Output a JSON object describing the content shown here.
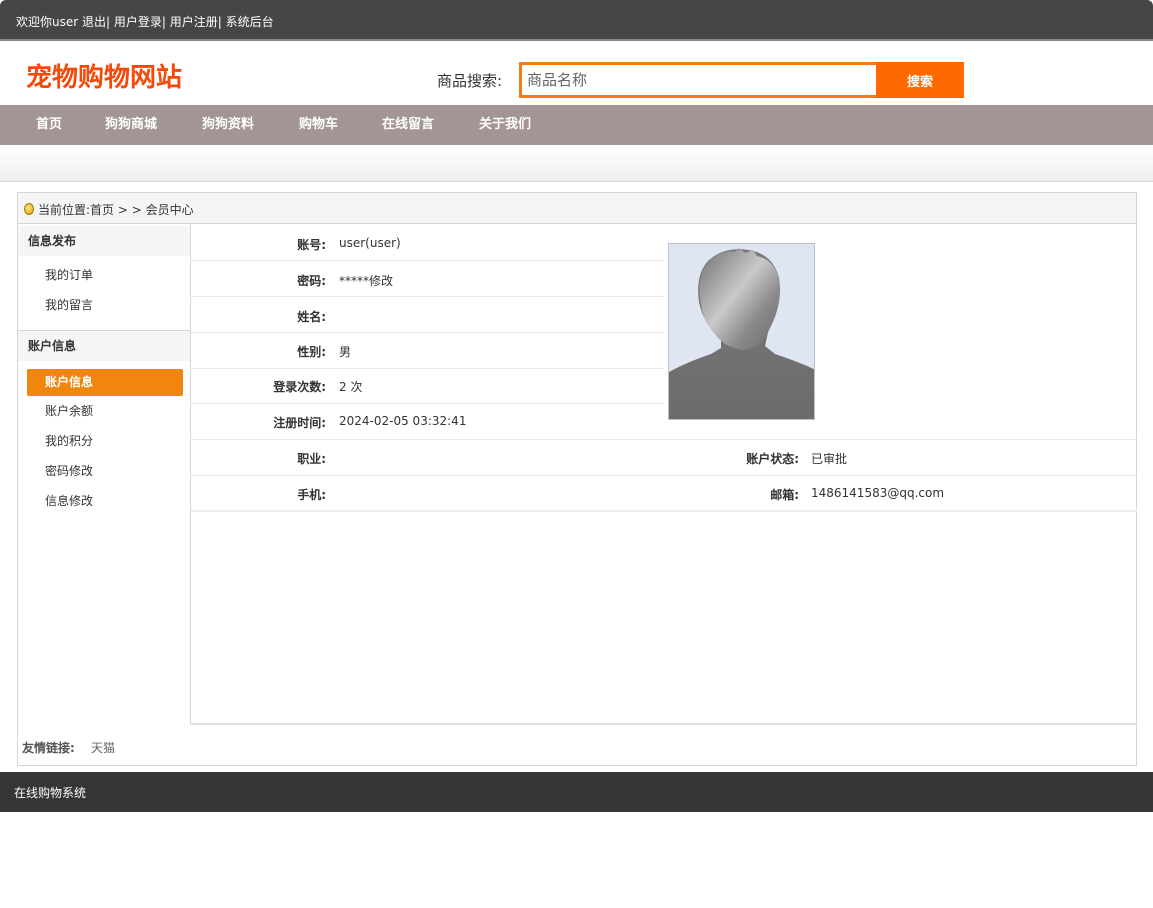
{
  "topbar": {
    "welcome": "欢迎你user",
    "logout": "退出|",
    "login": "用户登录|",
    "register": "用户注册|",
    "admin": "系统后台"
  },
  "header": {
    "logo": "宠物购物网站",
    "search_label": "商品搜索:",
    "search_placeholder": "商品名称",
    "search_button": "搜索"
  },
  "nav": {
    "items": [
      "首页",
      "狗狗商城",
      "狗狗资料",
      "购物车",
      "在线留言",
      "关于我们"
    ]
  },
  "breadcrumb": {
    "text": "当前位置:首页 > > 会员中心"
  },
  "sidebar": {
    "section1": "信息发布",
    "section1_items": [
      "我的订单",
      "我的留言"
    ],
    "section2": "账户信息",
    "section2_items": [
      "账户信息",
      "账户余额",
      "我的积分",
      "密码修改",
      "信息修改"
    ]
  },
  "profile": {
    "account_label": "账号:",
    "account_value": "user(user)",
    "password_label": "密码:",
    "password_value": "*****修改",
    "name_label": "姓名:",
    "name_value": "",
    "gender_label": "性别:",
    "gender_value": "男",
    "logins_label": "登录次数:",
    "logins_value": "2 次",
    "regtime_label": "注册时间:",
    "regtime_value": "2024-02-05 03:32:41",
    "job_label": "职业:",
    "job_value": "",
    "status_label": "账户状态:",
    "status_value": "已审批",
    "phone_label": "手机:",
    "phone_value": "",
    "email_label": "邮箱:",
    "email_value": "1486141583@qq.com"
  },
  "friends": {
    "label": "友情链接:",
    "links": [
      "天猫"
    ]
  },
  "footer": {
    "text": "在线购物系统"
  },
  "colors": {
    "accent": "#ff6a00",
    "logo": "#f24a0a",
    "nav_bg": "#a39593",
    "active_item": "#f0860e"
  }
}
